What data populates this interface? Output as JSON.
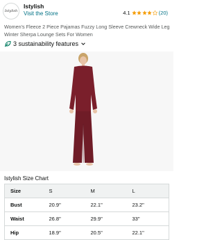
{
  "header": {
    "logo_text": "Istylish",
    "store_name": "Istylish",
    "visit_link": "Visit the Store",
    "rating": "4.1",
    "review_count": "(20)",
    "star_color": "#f59e0b",
    "stars_filled": 4
  },
  "product": {
    "title": "Women's Fleece 2 Piece Pajamas Fuzzy Long Sleeve Crewneck Wide Leg Winter Sherpa Lounge Sets For Women",
    "sustainability_label": "3 sustainability features",
    "garment_color": "#7a1f2b"
  },
  "size_chart": {
    "title": "Istylish Size Chart",
    "headers": [
      "Size",
      "S",
      "M",
      "L"
    ],
    "rows": [
      [
        "Bust",
        "20.9\"",
        "22.1\"",
        "23.2\""
      ],
      [
        "Waist",
        "26.8\"",
        "29.9\"",
        "33\""
      ],
      [
        "Hip",
        "18.9\"",
        "20.5\"",
        "22.1\""
      ]
    ]
  }
}
